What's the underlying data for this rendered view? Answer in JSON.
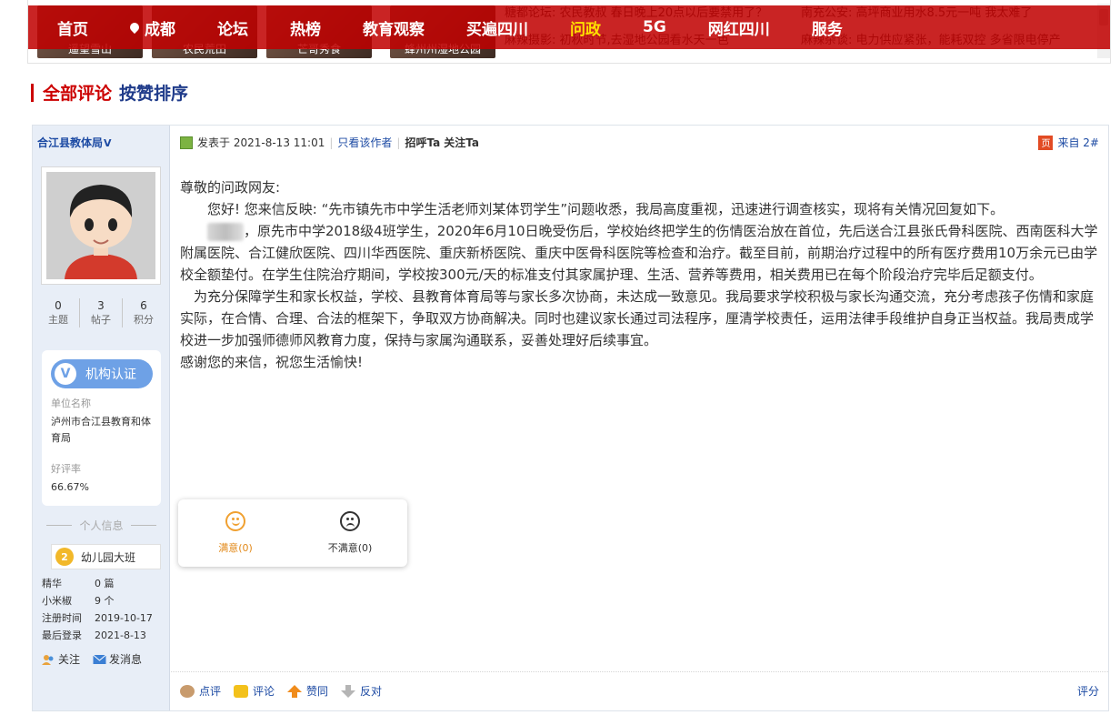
{
  "ticker": {
    "thumbs": [
      "遥望雪山",
      "农民荒田",
      "芒哥秀食",
      "蜂州州湿地公园"
    ],
    "news_col1": [
      "糖都论坛: 农民教叔 春日晚上20点以后要禁用了？",
      "麻辣摄影: 初秋时节,去湿地公园看水天一色"
    ],
    "news_col2": [
      "南充公安: 高坪商业用水8.5元一吨 我太难了",
      "麻辣杂谈: 电力供应紧张，能耗双控 多省限电停产"
    ]
  },
  "nav": {
    "items": [
      "首页",
      "成都",
      "论坛",
      "热榜",
      "教育观察",
      "买遍四川",
      "问政",
      "5G",
      "网红四川",
      "服务"
    ],
    "active": "问政"
  },
  "section": {
    "title_all": "全部评论",
    "title_sort": "按赞排序"
  },
  "author": {
    "name": "合江县教体局",
    "verified_mark": "V",
    "stats": [
      {
        "num": "0",
        "label": "主题"
      },
      {
        "num": "3",
        "label": "帖子"
      },
      {
        "num": "6",
        "label": "积分"
      }
    ],
    "cert_label": "机构认证",
    "unit_key": "单位名称",
    "unit_value": "泸州市合江县教育和体育局",
    "rate_key": "好评率",
    "rate_value": "66.67%",
    "personal_title": "个人信息",
    "level": "幼儿园大班",
    "info": [
      {
        "k": "精华",
        "v": "0 篇"
      },
      {
        "k": "小米椒",
        "v": "9 个"
      },
      {
        "k": "注册时间",
        "v": "2019-10-17"
      },
      {
        "k": "最后登录",
        "v": "2021-8-13"
      }
    ],
    "follow": "关注",
    "message": "发消息"
  },
  "post": {
    "posted_prefix": "发表于",
    "posted_time": "2021-8-13 11:01",
    "only_author": "只看该作者",
    "greet": "招呼Ta",
    "follow": "关注Ta",
    "from": "来自",
    "floor": "2#",
    "greeting": "尊敬的问政网友:",
    "p1": "您好! 您来信反映: “先市镇先市中学生活老师刘某体罚学生”问题收悉，我局高度重视，迅速进行调查核实，现将有关情况回复如下。",
    "p2": "，原先市中学2018级4班学生，2020年6月10日晚受伤后，学校始终把学生的伤情医治放在首位，先后送合江县张氏骨科医院、西南医科大学附属医院、合江健欣医院、四川华西医院、重庆新桥医院、重庆中医骨科医院等检查和治疗。截至目前，前期治疗过程中的所有医疗费用10万余元已由学校全额垫付。在学生住院治疗期间，学校按300元/天的标准支付其家属护理、生活、营养等费用，相关费用已在每个阶段治疗完毕后足额支付。",
    "p3": "为充分保障学生和家长权益，学校、县教育体育局等与家长多次协商，未达成一致意见。我局要求学校积极与家长沟通交流，充分考虑孩子伤情和家庭实际，在合情、合理、合法的框架下，争取双方协商解决。同时也建议家长通过司法程序，厘清学校责任，运用法律手段维护自身正当权益。我局责成学校进一步加强师德师风教育力度，保持与家属沟通联系，妥善处理好后续事宜。",
    "closing": "感谢您的来信，祝您生活愉快!",
    "satisfied": "满意(0)",
    "unsatisfied": "不满意(0)",
    "comment": "点评",
    "reply": "评论",
    "like": "赞同",
    "oppose": "反对",
    "score": "评分"
  }
}
